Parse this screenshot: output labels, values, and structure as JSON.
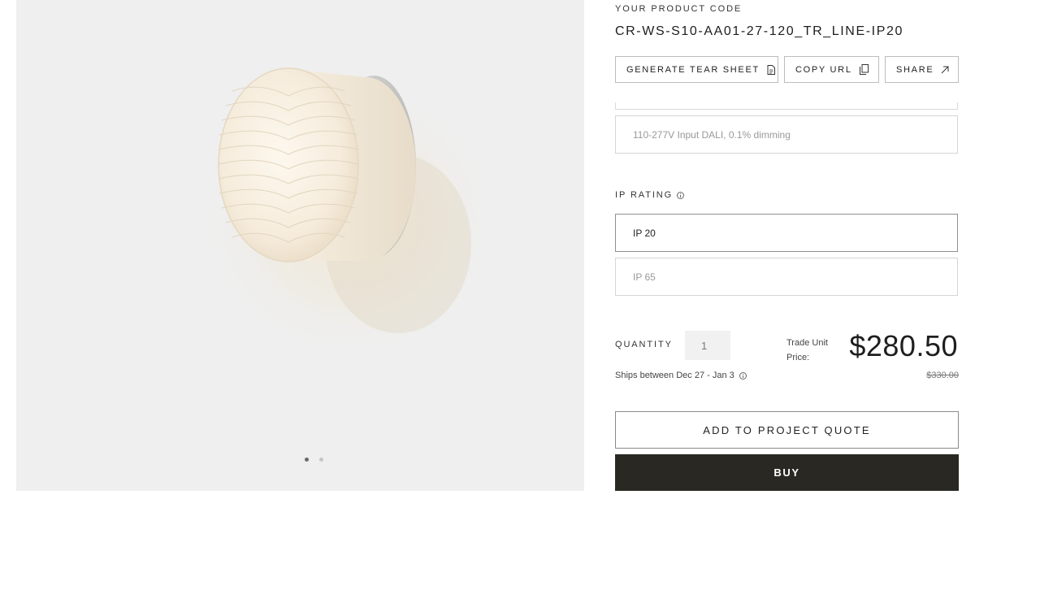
{
  "gallery": {
    "image_alt": "",
    "dots": [
      {
        "active": true
      },
      {
        "active": false
      }
    ]
  },
  "product": {
    "code_label": "YOUR PRODUCT CODE",
    "code_value": "CR-WS-S10-AA01-27-120_TR_LINE-IP20"
  },
  "actions": {
    "tear_sheet": "GENERATE TEAR SHEET",
    "copy_url": "COPY URL",
    "share": "SHARE"
  },
  "driver_option": "110-277V Input DALI, 0.1% dimming",
  "ip_rating": {
    "label": "IP RATING",
    "options": [
      {
        "label": "IP 20",
        "selected": true
      },
      {
        "label": "IP 65",
        "selected": false
      }
    ]
  },
  "purchase": {
    "quantity_label": "QUANTITY",
    "quantity_value": "1",
    "trade_label": "Trade Unit Price:",
    "price": "$280.50",
    "original_price": "$330.00",
    "ships_text": "Ships between Dec 27 - Jan 3",
    "add_quote_label": "ADD TO PROJECT QUOTE",
    "buy_label": "BUY"
  },
  "colors": {
    "buy_bg": "#2a2823",
    "gallery_bg": "#efefef"
  }
}
